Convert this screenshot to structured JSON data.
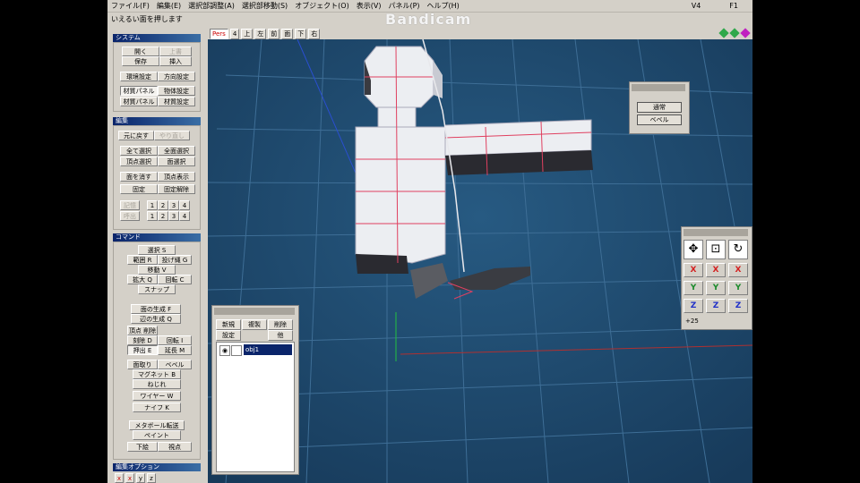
{
  "watermark": "Bandicam",
  "menu": [
    {
      "label": "ファイル(F)"
    },
    {
      "label": "編集(E)"
    },
    {
      "label": "選択部調整(A)"
    },
    {
      "label": "選択部移動(S)"
    },
    {
      "label": "オブジェクト(O)"
    },
    {
      "label": "表示(V)"
    },
    {
      "label": "パネル(P)"
    },
    {
      "label": "ヘルプ(H)"
    }
  ],
  "menu_right": [
    "V4",
    "F1"
  ],
  "status_text": "いえるい面を押します",
  "viewport_tabs": [
    {
      "label": "Pers",
      "selected": true
    },
    {
      "label": "4",
      "selected": false
    },
    {
      "label": "上",
      "selected": false
    },
    {
      "label": "左",
      "selected": false
    },
    {
      "label": "前",
      "selected": false
    },
    {
      "label": "面",
      "selected": false
    },
    {
      "label": "下",
      "selected": false
    },
    {
      "label": "右",
      "selected": false
    }
  ],
  "viewport_dots": [
    "#2ea84a",
    "#2ea84a",
    "#c020c0"
  ],
  "sections": {
    "system": {
      "title": "システム",
      "buttons": [
        "開く",
        "上書",
        "保存",
        "挿入",
        "環境設定",
        "方向設定",
        "材質パネル",
        "物体設定",
        "材質パネル",
        "材質設定"
      ]
    },
    "edit": {
      "title": "編集",
      "buttons": [
        "元に戻す",
        "やり直し",
        "全て選択",
        "全面選択",
        "頂点選択",
        "面選択",
        "面を消す",
        "頂点表示",
        "固定",
        "固定解除",
        "1",
        "2",
        "3",
        "4",
        "1",
        "2",
        "3",
        "4"
      ]
    },
    "command": {
      "title": "コマンド",
      "buttons": [
        "選択 S",
        "範囲 R",
        "投げ縄 G",
        "移動 V",
        "拡大 Q",
        "回転 C",
        "スナップ",
        "面の生成 F",
        "辺の生成 Q",
        "頂点 削除",
        "刻除 D",
        "回転 I",
        "押出 E",
        "延長 M",
        "面取り",
        "ベベル",
        "マグネット B",
        "ねじれ",
        "ワイヤー W",
        "ナイフ K",
        "メタボール転送",
        "ペイント",
        "下絵",
        "視点"
      ]
    },
    "edit_option": {
      "title": "編集オプション"
    }
  },
  "mini_panel": {
    "buttons": [
      "通常",
      "ベベル"
    ]
  },
  "xyz_panel": {
    "icons": [
      "move-icon",
      "scale-icon",
      "rotate-icon"
    ],
    "rows": [
      {
        "axis": "X",
        "color": "#d42020"
      },
      {
        "axis": "Y",
        "color": "#1a8a2a"
      },
      {
        "axis": "Z",
        "color": "#2030c8"
      }
    ],
    "footer": "+25"
  },
  "object_panel": {
    "buttons": [
      "新規",
      "複製",
      "削除",
      "設定",
      "他"
    ],
    "rows": [
      {
        "name": "obj1",
        "selected": true
      }
    ]
  }
}
